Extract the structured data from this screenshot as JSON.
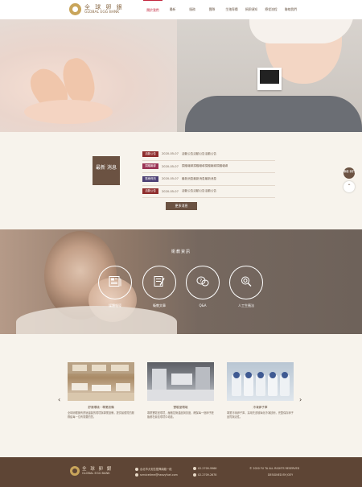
{
  "header": {
    "logo_cn": "全 球 卵 銀",
    "logo_en": "GLOBAL EGG BANK",
    "nav": [
      {
        "label": "關於我們",
        "active": true
      },
      {
        "label": "最新"
      },
      {
        "label": "服務"
      },
      {
        "label": "團隊"
      },
      {
        "label": "生殖專欄"
      },
      {
        "label": "捐卵須知"
      },
      {
        "label": "療程流程"
      },
      {
        "label": "聯絡我們"
      }
    ]
  },
  "news": {
    "badge": "最新 消息",
    "rows": [
      {
        "tag": "活動公告",
        "tag_color": "#8e2c2c",
        "date": "2020-05-07",
        "title": "活動公告活動公告活動公告"
      },
      {
        "tag": "捐贈報導",
        "tag_color": "#9a3354",
        "date": "2020-05-07",
        "title": "捐贈報導捐贈報導捐贈報導捐贈報導"
      },
      {
        "tag": "醫療資訊",
        "tag_color": "#4c3f74",
        "date": "2020-05-07",
        "title": "最新消息最新消息最新消息"
      },
      {
        "tag": "活動公告",
        "tag_color": "#8e2c2c",
        "date": "2020-05-07",
        "title": "活動公告活動公告活動公告"
      }
    ],
    "more": "更多消息"
  },
  "side": {
    "contact": "聯絡 我們",
    "top": "⌃"
  },
  "media": {
    "title": "衛教資訊",
    "items": [
      {
        "label": "媒體報導",
        "icon": "newspaper-icon"
      },
      {
        "label": "衛教文章",
        "icon": "article-icon"
      },
      {
        "label": "Q&A",
        "icon": "qa-icon"
      },
      {
        "label": "人工生殖法",
        "icon": "law-icon"
      }
    ]
  },
  "carousel": {
    "prev": "‹",
    "next": "›",
    "cards": [
      {
        "caption": "舒適環境・專業設備",
        "text": "全球卵銀擁有舒適溫馨的環境與專業設備，提供最優質的服務給每一位有需要的您。"
      },
      {
        "caption": "實驗室環境",
        "text": "專業實驗室環境，嚴格控管溫度與濕度，確保每一個卵子胚胎都在最佳環境中培養。"
      },
      {
        "caption": "冷凍卵子庫",
        "text": "專業冷凍卵子庫，採用先進玻璃化冷凍技術，完整保存卵子品質與活性。"
      }
    ]
  },
  "footer": {
    "logo_cn": "全 球 卵 銀",
    "logo_en": "GLOBAL EGG BANK",
    "address": "台北市大安區復興南路一段",
    "email": "servicetime@heavyfuel.com",
    "phone1": "02-2709-9966",
    "phone2": "02-2709-2678",
    "copyright": "© 2020 FU TA ALL RIGHTS RESERVED",
    "design": "DESIGNED BY JOEY"
  }
}
